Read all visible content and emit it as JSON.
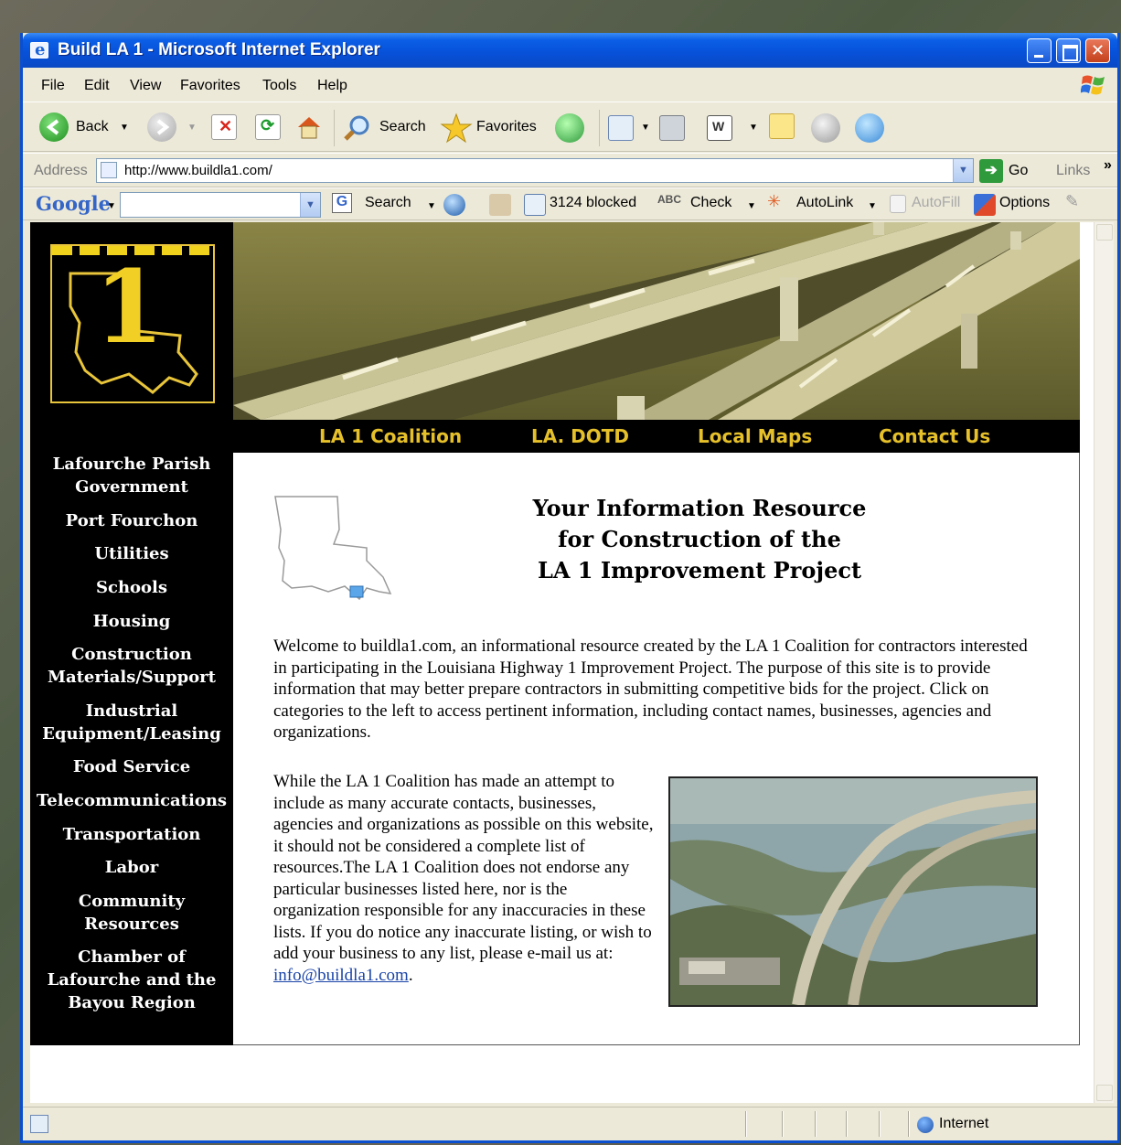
{
  "window": {
    "title": "Build LA 1 - Microsoft Internet Explorer"
  },
  "menu": [
    "File",
    "Edit",
    "View",
    "Favorites",
    "Tools",
    "Help"
  ],
  "toolbar": {
    "back_label": "Back",
    "search_label": "Search",
    "favorites_label": "Favorites"
  },
  "address": {
    "label": "Address",
    "url": "http://www.buildla1.com/",
    "go_label": "Go",
    "links_label": "Links",
    "chevron": "»"
  },
  "google_toolbar": {
    "brand": "Google",
    "search_label": "Search",
    "blocked_label": "3124 blocked",
    "check_label": "Check",
    "autolink_label": "AutoLink",
    "autofill_label": "AutoFill",
    "options_label": "Options"
  },
  "site": {
    "logo_numeral": "1",
    "nav": [
      "LA 1 Coalition",
      "LA. DOTD",
      "Local Maps",
      "Contact Us"
    ],
    "sidebar": [
      [
        "Lafourche Parish",
        "Government"
      ],
      [
        "Port Fourchon"
      ],
      [
        "Utilities"
      ],
      [
        "Schools"
      ],
      [
        "Housing"
      ],
      [
        "Construction",
        "Materials/Support"
      ],
      [
        "Industrial",
        "Equipment/Leasing"
      ],
      [
        "Food Service"
      ],
      [
        "Telecommunications"
      ],
      [
        "Transportation"
      ],
      [
        "Labor"
      ],
      [
        "Community",
        "Resources"
      ],
      [
        "Chamber of",
        "Lafourche and the",
        "Bayou Region"
      ]
    ],
    "headline": [
      "Your Information Resource",
      "for Construction of the",
      "LA 1 Improvement Project"
    ],
    "intro": "Welcome to buildla1.com, an informational resource created by the LA 1 Coalition for contractors interested in participating in the Louisiana Highway 1 Improvement Project. The purpose of this site is to provide information that may better prepare contractors in submitting competitive bids for the project. Click on categories to the left to access pertinent information, including contact names, businesses, agencies and organizations.",
    "disclaimer": "While the LA 1 Coalition has made an attempt to include as many accurate contacts, businesses, agencies and organizations as possible on this website, it should not be considered a complete list of resources.The LA 1 Coalition does not endorse any particular businesses listed here, nor is the organization responsible for any inaccuracies in these lists. If you do notice any inaccurate listing, or wish to add your business to any list, please e-mail us at:",
    "email": "info@buildla1.com",
    "email_suffix": "."
  },
  "status": {
    "zone": "Internet"
  },
  "colors": {
    "titlebar": "#0b5fe6",
    "nav_gold": "#e6c02a",
    "chrome": "#ece9d8"
  }
}
